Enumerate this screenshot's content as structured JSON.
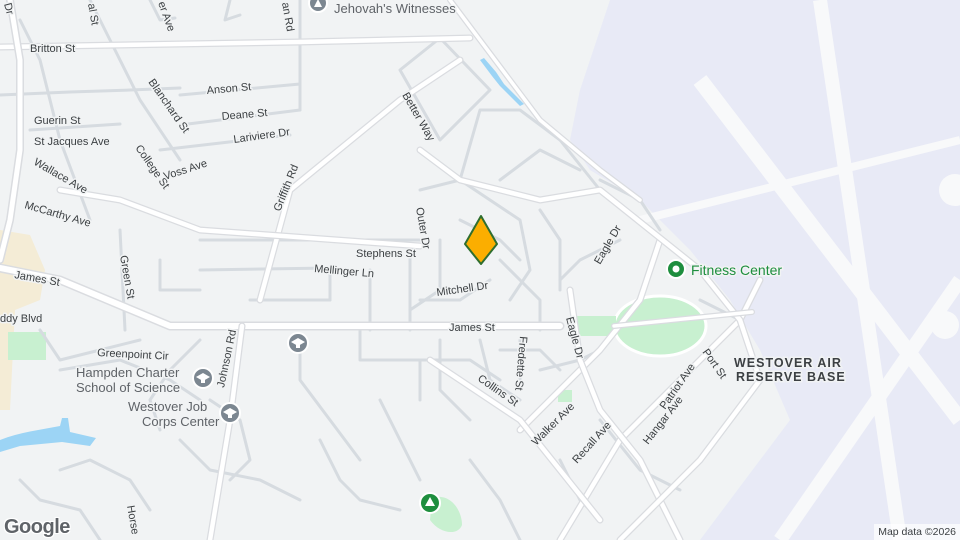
{
  "map": {
    "streets": {
      "britton_st": "Britton St",
      "anson_st": "Anson St",
      "deane_st": "Deane St",
      "lariviere_dr": "Lariviere Dr",
      "guerin_st": "Guerin St",
      "st_jacques_ave": "St Jacques Ave",
      "blanchard_st": "Blanchard St",
      "college_st": "College St",
      "voss_ave": "Voss Ave",
      "wallace_ave": "Wallace Ave",
      "mccarthy_ave": "McCarthy Ave",
      "griffith_rd": "Griffith Rd",
      "better_way": "Better Way",
      "outer_dr": "Outer Dr",
      "stephens_st": "Stephens St",
      "mellinger_ln": "Mellinger Ln",
      "mitchell_dr": "Mitchell Dr",
      "green_st": "Green St",
      "james_st_west": "James St",
      "james_st": "James St",
      "eagle_dr_north": "Eagle Dr",
      "eagle_dr": "Eagle Dr",
      "fredette_st": "Fredette St",
      "collins_st": "Collins St",
      "walker_ave": "Walker Ave",
      "recall_ave": "Recall Ave",
      "hangar_ave": "Hangar Ave",
      "patriot_ave": "Patriot Ave",
      "port_st": "Port St",
      "greenpoint_cir": "Greenpoint Cir",
      "johnson_rd": "Johnson Rd",
      "horse": "Horse",
      "ddy_blvd": "ddy Blvd",
      "top_ave": "er Ave",
      "top_al_st": "al St",
      "top_an_rd": "an Rd",
      "left_dr": "Dr"
    },
    "pois": {
      "jehovahs_witnesses": "Jehovah's Witnesses",
      "fitness_center": "Fitness Center",
      "hampden_charter_line1": "Hampden Charter",
      "hampden_charter_line2": "School of Science",
      "westover_job_line1": "Westover Job",
      "westover_job_line2": "Corps Center"
    },
    "base_label_line1": "WESTOVER AIR",
    "base_label_line2": "RESERVE BASE",
    "colors": {
      "background": "#f1f3f4",
      "airbase": "#e8eaf6",
      "park": "#c8f0d0",
      "water": "#9cd4f5",
      "pin": "#fbae00",
      "pin_outline": "#2f6e2f",
      "poi_green": "#1e8e3e",
      "poi_gray": "#7c8791"
    },
    "icons": {
      "worship": "place-of-worship-icon",
      "school": "school-icon",
      "gym": "fitness-icon",
      "park": "park-icon",
      "pin": "location-pin-icon"
    }
  },
  "footer": {
    "logo": "Google",
    "attribution": "Map data ©2026"
  }
}
